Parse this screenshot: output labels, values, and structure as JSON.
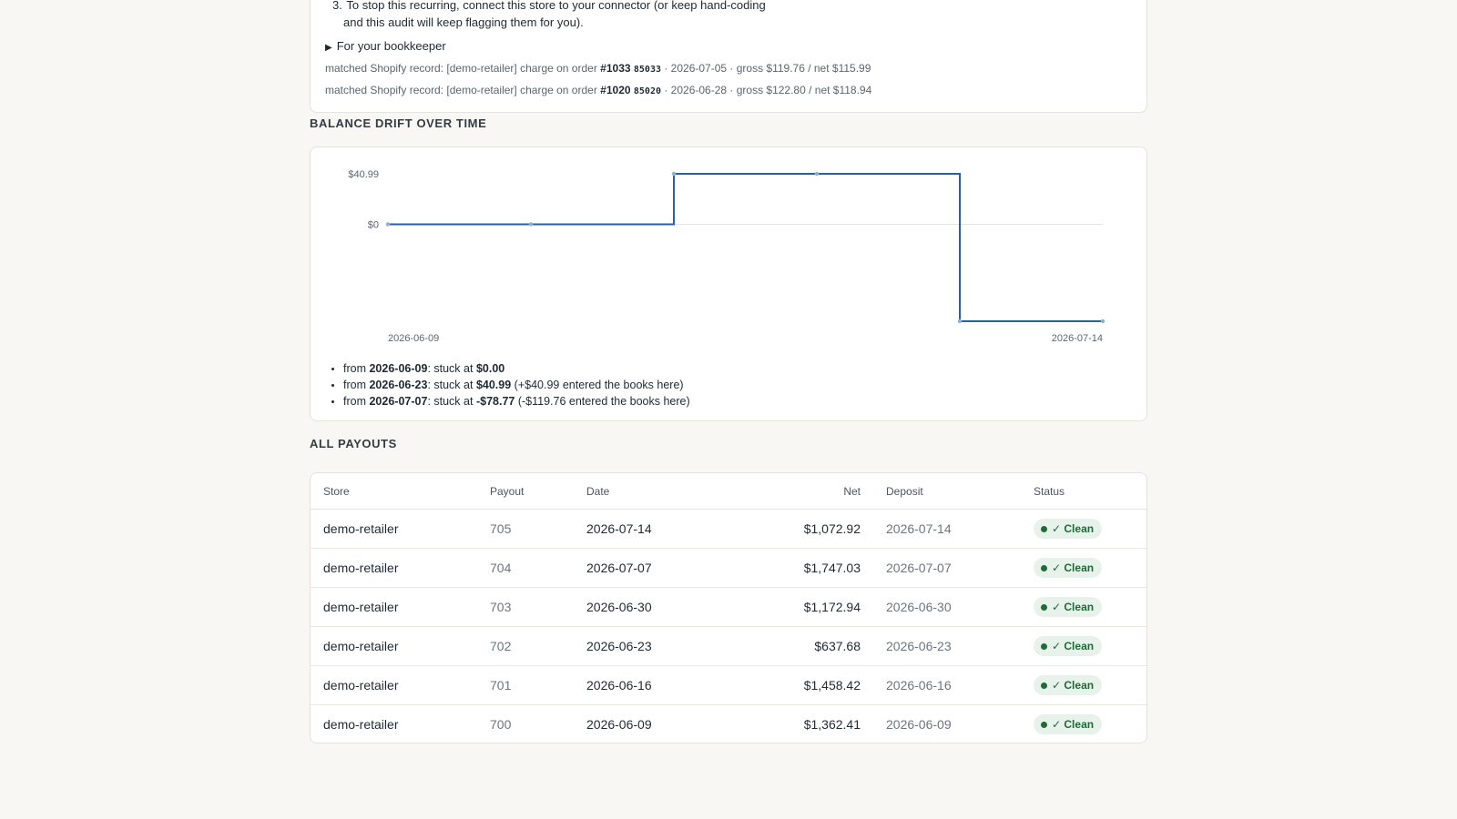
{
  "findings": {
    "step_number": "3.",
    "step_line1": "To stop this recurring, connect this store to your connector (or keep hand-coding",
    "step_line2": "and this audit will keep flagging them for you).",
    "bookkeeper_toggle": "For your bookkeeper",
    "matches": [
      {
        "prefix": "matched Shopify record: [demo-retailer] charge on order",
        "order": "#1033",
        "code": "85033",
        "suffix": "· 2026-07-05 · gross $119.76 / net $115.99"
      },
      {
        "prefix": "matched Shopify record: [demo-retailer] charge on order",
        "order": "#1020",
        "code": "85020",
        "suffix": "· 2026-06-28 · gross $122.80 / net $118.94"
      }
    ]
  },
  "drift": {
    "section_title": "Balance drift over time",
    "items": [
      {
        "from": "from",
        "date": "2026-06-09",
        "mid": ": stuck at",
        "amount": "$0.00",
        "note": ""
      },
      {
        "from": "from",
        "date": "2026-06-23",
        "mid": ": stuck at",
        "amount": "$40.99",
        "note": "(+$40.99 entered the books here)"
      },
      {
        "from": "from",
        "date": "2026-07-07",
        "mid": ": stuck at",
        "amount": "-$78.77",
        "note": "(-$119.76 entered the books here)"
      }
    ]
  },
  "chart_data": {
    "type": "line",
    "step": true,
    "x": [
      "2026-06-09",
      "2026-06-16",
      "2026-06-23",
      "2026-06-30",
      "2026-07-07",
      "2026-07-14"
    ],
    "values": [
      0,
      0,
      40.99,
      40.99,
      -78.77,
      -78.77
    ],
    "x_tick_labels": [
      "2026-06-09",
      "2026-07-14"
    ],
    "y_tick_labels": [
      "$40.99",
      "$0"
    ],
    "y_ticks": [
      40.99,
      0
    ],
    "ylim": [
      -78.77,
      40.99
    ],
    "line_color": "#2a5fa0",
    "grid": "zero-line only"
  },
  "payouts": {
    "section_title": "All payouts",
    "columns": [
      "Store",
      "Payout",
      "Date",
      "Net",
      "Deposit",
      "Status"
    ],
    "rows": [
      {
        "store": "demo-retailer",
        "payout": "705",
        "date": "2026-07-14",
        "net": "$1,072.92",
        "deposit": "2026-07-14",
        "status": "✓ Clean"
      },
      {
        "store": "demo-retailer",
        "payout": "704",
        "date": "2026-07-07",
        "net": "$1,747.03",
        "deposit": "2026-07-07",
        "status": "✓ Clean"
      },
      {
        "store": "demo-retailer",
        "payout": "703",
        "date": "2026-06-30",
        "net": "$1,172.94",
        "deposit": "2026-06-30",
        "status": "✓ Clean"
      },
      {
        "store": "demo-retailer",
        "payout": "702",
        "date": "2026-06-23",
        "net": "$637.68",
        "deposit": "2026-06-23",
        "status": "✓ Clean"
      },
      {
        "store": "demo-retailer",
        "payout": "701",
        "date": "2026-06-16",
        "net": "$1,458.42",
        "deposit": "2026-06-16",
        "status": "✓ Clean"
      },
      {
        "store": "demo-retailer",
        "payout": "700",
        "date": "2026-06-09",
        "net": "$1,362.41",
        "deposit": "2026-06-09",
        "status": "✓ Clean"
      }
    ]
  },
  "colors": {
    "background": "#f8f7f4",
    "clean_badge_bg": "#e7f3ea",
    "clean_badge_fg": "#1e6b36"
  }
}
